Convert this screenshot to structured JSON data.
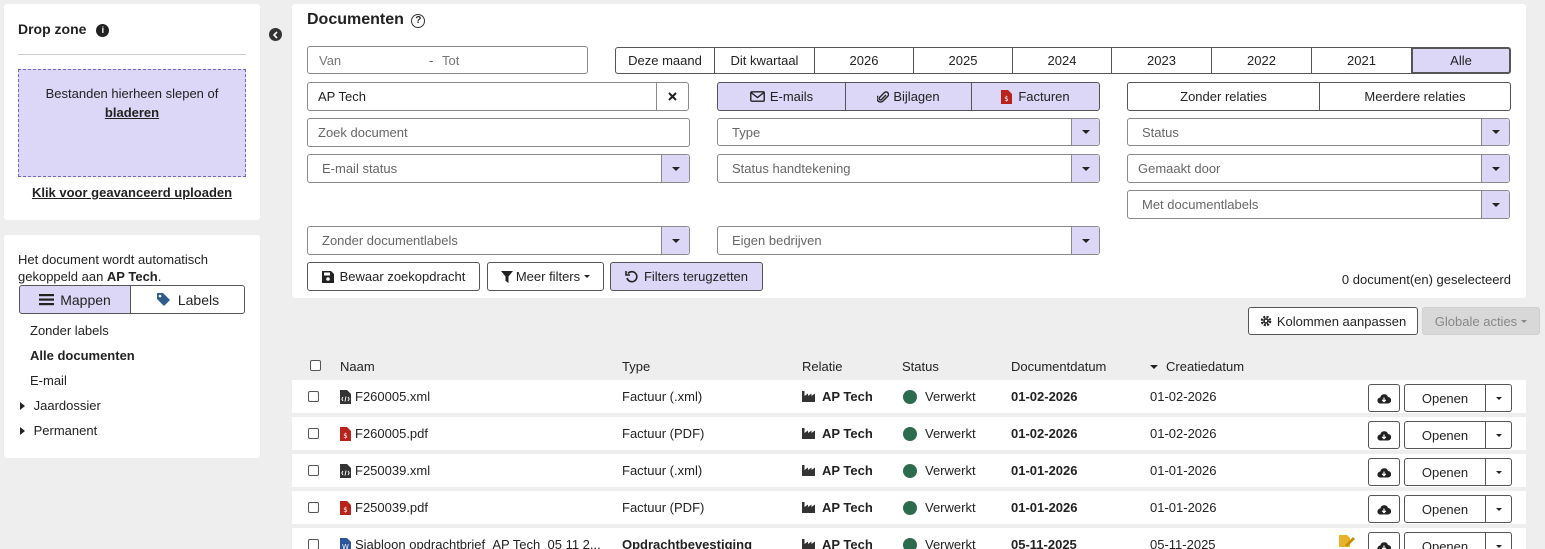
{
  "dropzone": {
    "title": "Drop zone",
    "area_text": "Bestanden hierheen slepen of",
    "browse_link": "bladeren",
    "advanced_link": "Klik voor geavanceerd uploaden"
  },
  "sidebar": {
    "info_prefix": "Het document wordt automatisch gekoppeld aan ",
    "info_company": "AP Tech",
    "info_suffix": ".",
    "tab_folders": "Mappen",
    "tab_labels": "Labels",
    "items": [
      {
        "label": "Zonder labels"
      },
      {
        "label": "Alle documenten"
      },
      {
        "label": "E-mail"
      },
      {
        "label": "Jaardossier"
      },
      {
        "label": "Permanent"
      }
    ]
  },
  "documents": {
    "title": "Documenten",
    "date_from": "Van",
    "date_sep": "-",
    "date_to": "Tot",
    "periods": [
      "Deze maand",
      "Dit kwartaal",
      "2026",
      "2025",
      "2024",
      "2023",
      "2022",
      "2021",
      "Alle"
    ],
    "relation_value": "AP Tech",
    "types": {
      "emails": "E-mails",
      "attachments": "Bijlagen",
      "invoices": "Facturen"
    },
    "relations": {
      "none": "Zonder relaties",
      "multiple": "Meerdere relaties"
    },
    "search_placeholder": "Zoek document",
    "type_placeholder": "Type",
    "status_placeholder": "Status",
    "email_status_placeholder": "E-mail status",
    "signature_placeholder": "Status handtekening",
    "created_by_placeholder": "Gemaakt door",
    "with_labels_placeholder": "Met documentlabels",
    "without_labels_placeholder": "Zonder documentlabels",
    "own_companies_placeholder": "Eigen bedrijven",
    "save_search": "Bewaar zoekopdracht",
    "more_filters": "Meer filters",
    "reset_filters": "Filters terugzetten",
    "selected_count": "0 document(en) geselecteerd"
  },
  "toolbar": {
    "columns": "Kolommen aanpassen",
    "global_actions": "Globale acties"
  },
  "table": {
    "headers": {
      "name": "Naam",
      "type": "Type",
      "relation": "Relatie",
      "status": "Status",
      "docdate": "Documentdatum",
      "created": "Creatiedatum"
    },
    "open_label": "Openen",
    "rows": [
      {
        "name": "F260005.xml",
        "type": "Factuur (.xml)",
        "relation": "AP Tech",
        "status": "Verwerkt",
        "docdate": "01-02-2026",
        "created": "01-02-2026",
        "icon": "xml-file-icon"
      },
      {
        "name": "F260005.pdf",
        "type": "Factuur (PDF)",
        "relation": "AP Tech",
        "status": "Verwerkt",
        "docdate": "01-02-2026",
        "created": "01-02-2026",
        "icon": "invoice-pdf-icon"
      },
      {
        "name": "F250039.xml",
        "type": "Factuur (.xml)",
        "relation": "AP Tech",
        "status": "Verwerkt",
        "docdate": "01-01-2026",
        "created": "01-01-2026",
        "icon": "xml-file-icon"
      },
      {
        "name": "F250039.pdf",
        "type": "Factuur (PDF)",
        "relation": "AP Tech",
        "status": "Verwerkt",
        "docdate": "01-01-2026",
        "created": "01-01-2026",
        "icon": "invoice-pdf-icon"
      },
      {
        "name": "Sjabloon opdrachtbrief_AP Tech_05 11 2...",
        "type": "Opdrachtbevestiging",
        "relation": "AP Tech",
        "status": "Verwerkt",
        "docdate": "05-11-2025",
        "created": "05-11-2025",
        "icon": "word-file-icon"
      }
    ]
  },
  "colors": {
    "accent": "#dcd6f7",
    "status_green": "#2d6b4e",
    "pdf_red": "#b8231b"
  }
}
